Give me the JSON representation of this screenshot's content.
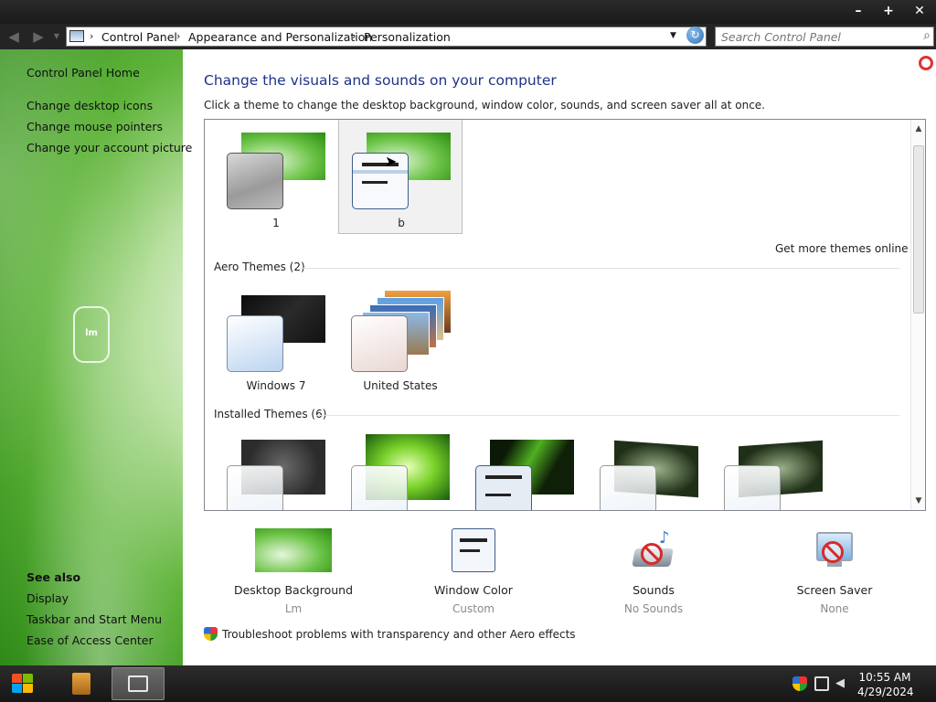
{
  "window": {
    "minimize": "–",
    "maximize": "+",
    "close": "✕"
  },
  "address": {
    "crumbs": [
      "Control Panel",
      "Appearance and Personalization",
      "Personalization"
    ],
    "separator": "›",
    "dropdown_icon": "chevron-down-icon",
    "refresh_icon": "refresh-icon"
  },
  "search": {
    "placeholder": "Search Control Panel",
    "icon": "search-icon"
  },
  "sidebar": {
    "home": "Control Panel Home",
    "links": [
      "Change desktop icons",
      "Change mouse pointers",
      "Change your account picture"
    ],
    "logo_text": "lm",
    "see_also_title": "See also",
    "see_also": [
      "Display",
      "Taskbar and Start Menu",
      "Ease of Access Center"
    ]
  },
  "main": {
    "title": "Change the visuals and sounds on your computer",
    "subtitle": "Click a theme to change the desktop background, window color, sounds, and screen saver all at once.",
    "my_themes": [
      {
        "label": "1"
      },
      {
        "label": "b",
        "selected": true
      }
    ],
    "get_more": "Get more themes online",
    "aero_title": "Aero Themes (2)",
    "aero_themes": [
      {
        "label": "Windows 7"
      },
      {
        "label": "United States"
      }
    ],
    "installed_title": "Installed Themes (6)"
  },
  "settings": [
    {
      "title": "Desktop Background",
      "value": "Lm"
    },
    {
      "title": "Window Color",
      "value": "Custom"
    },
    {
      "title": "Sounds",
      "value": "No Sounds"
    },
    {
      "title": "Screen Saver",
      "value": "None"
    }
  ],
  "troubleshoot": "Troubleshoot problems with transparency and other Aero effects",
  "taskbar": {
    "time": "10:55 AM",
    "date": "4/29/2024"
  },
  "colors": {
    "title_blue": "#1e3287",
    "sidebar_green": "#5fb43a"
  }
}
